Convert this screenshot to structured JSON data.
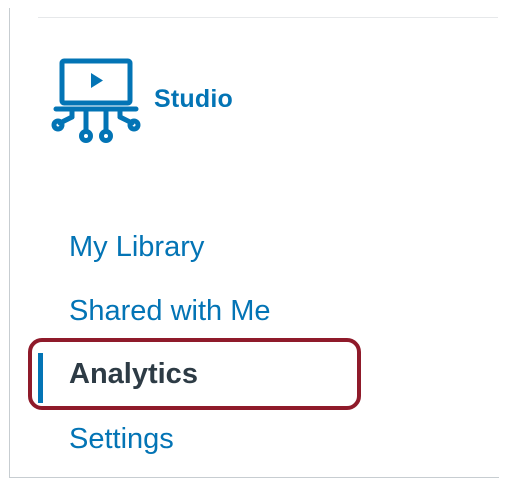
{
  "app": {
    "name": "Studio",
    "logo_icon": "studio-screen-circuit-icon",
    "accent_color": "#0374b5"
  },
  "nav": {
    "items": [
      {
        "label": "My Library",
        "active": false
      },
      {
        "label": "Shared with Me",
        "active": false
      },
      {
        "label": "Analytics",
        "active": true
      },
      {
        "label": "Settings",
        "active": false
      }
    ]
  },
  "annotation": {
    "highlight_color": "#8f1a2a",
    "highlighted_item": "Analytics"
  }
}
